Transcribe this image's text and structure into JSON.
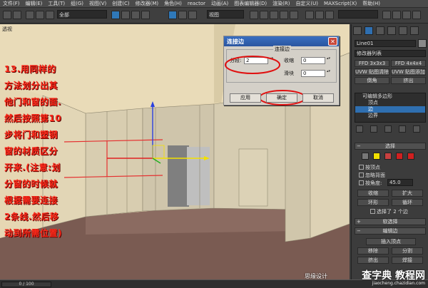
{
  "menu": [
    "文件(F)",
    "编辑(E)",
    "工具(T)",
    "组(G)",
    "视图(V)",
    "创建(C)",
    "修改器(M)",
    "角色(H)",
    "reactor",
    "动画(A)",
    "图表编辑器(D)",
    "渲染(R)",
    "自定义(U)",
    "MAXScript(X)",
    "帮助(H)"
  ],
  "toolbar": {
    "selection_filter": "全部",
    "view_dropdown": "视图"
  },
  "viewport": {
    "label": "透视",
    "note_lines": [
      "13.用同样的",
      "方法划分出其",
      "他门和窗的面.",
      "然后按照第10",
      "步将门和塑钢",
      "窗的材质区分",
      "开来.(注意:划",
      "分窗的时候就",
      "根据需要连接",
      "2条线.然后移",
      "动到所需位置)"
    ]
  },
  "dialog": {
    "title": "连接边",
    "group_label": "连接边",
    "segments_label": "分段:",
    "segments_value": "2",
    "pinch_label": "收缩",
    "pinch_value": "0",
    "slide_label": "滑块",
    "slide_value": "0",
    "apply_label": "应用",
    "ok_label": "确定",
    "cancel_label": "取消"
  },
  "panel": {
    "object_name": "Line01",
    "modifier_list": "修改器列表",
    "btn_3x3": "FFD 3x3x3",
    "btn_4x4": "FFD 4x4x4",
    "btn_uvw_clear": "UVW 贴图清除",
    "btn_uvw_add": "UVW 贴图添加",
    "btn_blank1": "倒角",
    "btn_blank2": "挤出",
    "stack_items": [
      "可编辑多边形",
      "顶点",
      "边",
      "边界"
    ],
    "stack_selected": 2,
    "rollout_select": "选择",
    "by_vertex": "按顶点",
    "ignore_backfacing": "忽略背面",
    "by_angle": "按角度:",
    "angle_value": "45.0",
    "shrink": "收缩",
    "grow": "扩大",
    "ring": "环形",
    "loop": "循环",
    "selected_count": "选择了 2 个边",
    "rollout_soft": "软选择",
    "rollout_edit": "编辑边",
    "insert_vertex": "插入顶点",
    "remove": "移除",
    "split": "分割",
    "extrude": "挤出",
    "weld": "焊接"
  },
  "statusbar": {
    "frame": "0 / 100"
  },
  "watermark": {
    "left_text": "思缘设计",
    "brand": "查字典 教程网",
    "url": "jiaocheng.chazidian.com"
  }
}
